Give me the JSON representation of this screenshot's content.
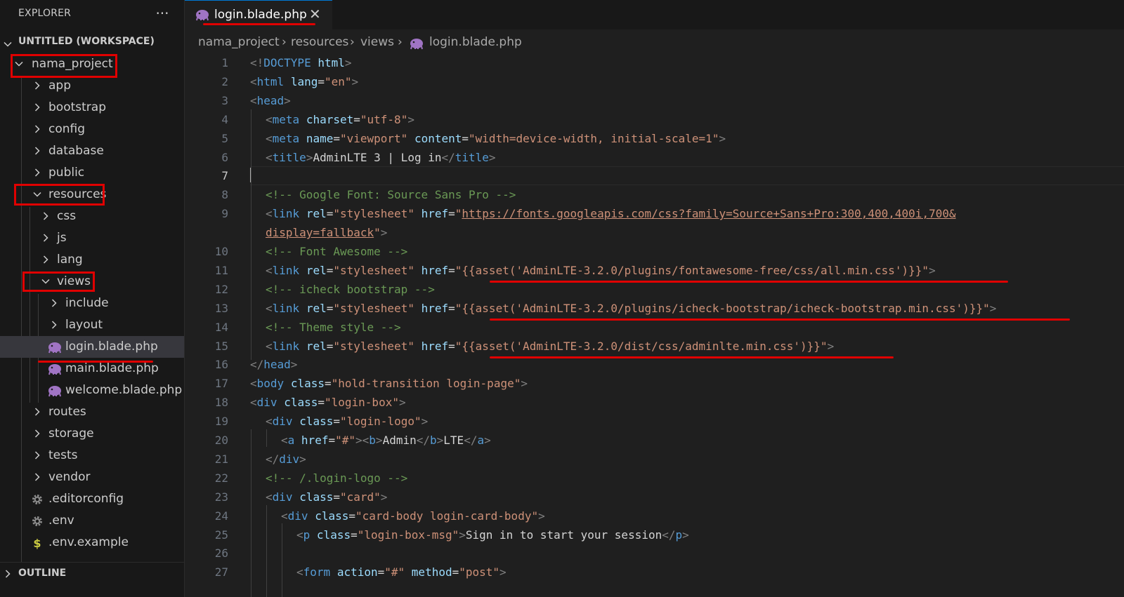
{
  "sidebar": {
    "title": "EXPLORER",
    "more": "···",
    "workspace": "UNTITLED (WORKSPACE)",
    "items": [
      {
        "label": "nama_project",
        "kind": "folder",
        "open": true
      },
      {
        "label": "app",
        "kind": "folder",
        "open": false
      },
      {
        "label": "bootstrap",
        "kind": "folder",
        "open": false
      },
      {
        "label": "config",
        "kind": "folder",
        "open": false
      },
      {
        "label": "database",
        "kind": "folder",
        "open": false
      },
      {
        "label": "public",
        "kind": "folder",
        "open": false
      },
      {
        "label": "resources",
        "kind": "folder",
        "open": true
      },
      {
        "label": "css",
        "kind": "folder",
        "open": false
      },
      {
        "label": "js",
        "kind": "folder",
        "open": false
      },
      {
        "label": "lang",
        "kind": "folder",
        "open": false
      },
      {
        "label": "views",
        "kind": "folder",
        "open": true
      },
      {
        "label": "include",
        "kind": "folder",
        "open": false
      },
      {
        "label": "layout",
        "kind": "folder",
        "open": false
      },
      {
        "label": "login.blade.php",
        "kind": "php",
        "selected": true
      },
      {
        "label": "main.blade.php",
        "kind": "php"
      },
      {
        "label": "welcome.blade.php",
        "kind": "php"
      },
      {
        "label": "routes",
        "kind": "folder",
        "open": false
      },
      {
        "label": "storage",
        "kind": "folder",
        "open": false
      },
      {
        "label": "tests",
        "kind": "folder",
        "open": false
      },
      {
        "label": "vendor",
        "kind": "folder",
        "open": false
      },
      {
        "label": ".editorconfig",
        "kind": "gear"
      },
      {
        "label": ".env",
        "kind": "gear"
      },
      {
        "label": ".env.example",
        "kind": "dollar"
      }
    ],
    "outline": "OUTLINE"
  },
  "tab": {
    "label": "login.blade.php",
    "close": "✕"
  },
  "breadcrumb": {
    "parts": [
      "nama_project",
      "resources",
      "views",
      "login.blade.php"
    ],
    "sep": "›"
  },
  "colors": {
    "accent": "#0078d4",
    "highlight_red": "#e00000",
    "php_icon": "#a074c4"
  },
  "editor": {
    "active_line": "7",
    "lines": [
      {
        "n": "1",
        "i": 0,
        "t": [
          [
            "p",
            "<!"
          ],
          [
            "t",
            "DOCTYPE"
          ],
          [
            "x",
            " "
          ],
          [
            "a",
            "html"
          ],
          [
            "p",
            ">"
          ]
        ]
      },
      {
        "n": "2",
        "i": 0,
        "t": [
          [
            "p",
            "<"
          ],
          [
            "t",
            "html"
          ],
          [
            "x",
            " "
          ],
          [
            "a",
            "lang"
          ],
          [
            "x",
            "="
          ],
          [
            "s",
            "\"en\""
          ],
          [
            "p",
            ">"
          ]
        ]
      },
      {
        "n": "3",
        "i": 0,
        "t": [
          [
            "p",
            "<"
          ],
          [
            "t",
            "head"
          ],
          [
            "p",
            ">"
          ]
        ]
      },
      {
        "n": "4",
        "i": 1,
        "t": [
          [
            "p",
            "<"
          ],
          [
            "t",
            "meta"
          ],
          [
            "x",
            " "
          ],
          [
            "a",
            "charset"
          ],
          [
            "x",
            "="
          ],
          [
            "s",
            "\"utf-8\""
          ],
          [
            "p",
            ">"
          ]
        ]
      },
      {
        "n": "5",
        "i": 1,
        "t": [
          [
            "p",
            "<"
          ],
          [
            "t",
            "meta"
          ],
          [
            "x",
            " "
          ],
          [
            "a",
            "name"
          ],
          [
            "x",
            "="
          ],
          [
            "s",
            "\"viewport\""
          ],
          [
            "x",
            " "
          ],
          [
            "a",
            "content"
          ],
          [
            "x",
            "="
          ],
          [
            "s",
            "\"width=device-width, initial-scale=1\""
          ],
          [
            "p",
            ">"
          ]
        ]
      },
      {
        "n": "6",
        "i": 1,
        "t": [
          [
            "p",
            "<"
          ],
          [
            "t",
            "title"
          ],
          [
            "p",
            ">"
          ],
          [
            "x",
            "AdminLTE 3 | Log in"
          ],
          [
            "p",
            "</"
          ],
          [
            "t",
            "title"
          ],
          [
            "p",
            ">"
          ]
        ]
      },
      {
        "n": "7",
        "i": 0,
        "t": []
      },
      {
        "n": "8",
        "i": 1,
        "t": [
          [
            "c",
            "<!-- Google Font: Source Sans Pro -->"
          ]
        ]
      },
      {
        "n": "9",
        "i": 1,
        "t": [
          [
            "p",
            "<"
          ],
          [
            "t",
            "link"
          ],
          [
            "x",
            " "
          ],
          [
            "a",
            "rel"
          ],
          [
            "x",
            "="
          ],
          [
            "s",
            "\"stylesheet\""
          ],
          [
            "x",
            " "
          ],
          [
            "a",
            "href"
          ],
          [
            "x",
            "="
          ],
          [
            "s",
            "\""
          ],
          [
            "u",
            "https://fonts.googleapis.com/css?family=Source+Sans+Pro:300,400,400i,700&"
          ]
        ]
      },
      {
        "n": "",
        "i": 1,
        "t": [
          [
            "u",
            "display=fallback"
          ],
          [
            "s",
            "\""
          ],
          [
            "p",
            ">"
          ]
        ]
      },
      {
        "n": "10",
        "i": 1,
        "t": [
          [
            "c",
            "<!-- Font Awesome -->"
          ]
        ]
      },
      {
        "n": "11",
        "i": 1,
        "t": [
          [
            "p",
            "<"
          ],
          [
            "t",
            "link"
          ],
          [
            "x",
            " "
          ],
          [
            "a",
            "rel"
          ],
          [
            "x",
            "="
          ],
          [
            "s",
            "\"stylesheet\""
          ],
          [
            "x",
            " "
          ],
          [
            "a",
            "href"
          ],
          [
            "x",
            "="
          ],
          [
            "s",
            "\"{{asset('AdminLTE-3.2.0/plugins/fontawesome-free/css/all.min.css')}}\""
          ],
          [
            "p",
            ">"
          ]
        ]
      },
      {
        "n": "12",
        "i": 1,
        "t": [
          [
            "c",
            "<!-- icheck bootstrap -->"
          ]
        ]
      },
      {
        "n": "13",
        "i": 1,
        "t": [
          [
            "p",
            "<"
          ],
          [
            "t",
            "link"
          ],
          [
            "x",
            " "
          ],
          [
            "a",
            "rel"
          ],
          [
            "x",
            "="
          ],
          [
            "s",
            "\"stylesheet\""
          ],
          [
            "x",
            " "
          ],
          [
            "a",
            "href"
          ],
          [
            "x",
            "="
          ],
          [
            "s",
            "\"{{asset('AdminLTE-3.2.0/plugins/icheck-bootstrap/icheck-bootstrap.min.css')}}\""
          ],
          [
            "p",
            ">"
          ]
        ]
      },
      {
        "n": "14",
        "i": 1,
        "t": [
          [
            "c",
            "<!-- Theme style -->"
          ]
        ]
      },
      {
        "n": "15",
        "i": 1,
        "t": [
          [
            "p",
            "<"
          ],
          [
            "t",
            "link"
          ],
          [
            "x",
            " "
          ],
          [
            "a",
            "rel"
          ],
          [
            "x",
            "="
          ],
          [
            "s",
            "\"stylesheet\""
          ],
          [
            "x",
            " "
          ],
          [
            "a",
            "href"
          ],
          [
            "x",
            "="
          ],
          [
            "s",
            "\"{{asset('AdminLTE-3.2.0/dist/css/adminlte.min.css')}}\""
          ],
          [
            "p",
            ">"
          ]
        ]
      },
      {
        "n": "16",
        "i": 0,
        "t": [
          [
            "p",
            "</"
          ],
          [
            "t",
            "head"
          ],
          [
            "p",
            ">"
          ]
        ]
      },
      {
        "n": "17",
        "i": 0,
        "t": [
          [
            "p",
            "<"
          ],
          [
            "t",
            "body"
          ],
          [
            "x",
            " "
          ],
          [
            "a",
            "class"
          ],
          [
            "x",
            "="
          ],
          [
            "s",
            "\"hold-transition login-page\""
          ],
          [
            "p",
            ">"
          ]
        ]
      },
      {
        "n": "18",
        "i": 0,
        "t": [
          [
            "p",
            "<"
          ],
          [
            "t",
            "div"
          ],
          [
            "x",
            " "
          ],
          [
            "a",
            "class"
          ],
          [
            "x",
            "="
          ],
          [
            "s",
            "\"login-box\""
          ],
          [
            "p",
            ">"
          ]
        ]
      },
      {
        "n": "19",
        "i": 1,
        "t": [
          [
            "p",
            "<"
          ],
          [
            "t",
            "div"
          ],
          [
            "x",
            " "
          ],
          [
            "a",
            "class"
          ],
          [
            "x",
            "="
          ],
          [
            "s",
            "\"login-logo\""
          ],
          [
            "p",
            ">"
          ]
        ]
      },
      {
        "n": "20",
        "i": 2,
        "t": [
          [
            "p",
            "<"
          ],
          [
            "t",
            "a"
          ],
          [
            "x",
            " "
          ],
          [
            "a",
            "href"
          ],
          [
            "x",
            "="
          ],
          [
            "s",
            "\"#\""
          ],
          [
            "p",
            ">"
          ],
          [
            "p",
            "<"
          ],
          [
            "t",
            "b"
          ],
          [
            "p",
            ">"
          ],
          [
            "x",
            "Admin"
          ],
          [
            "p",
            "</"
          ],
          [
            "t",
            "b"
          ],
          [
            "p",
            ">"
          ],
          [
            "x",
            "LTE"
          ],
          [
            "p",
            "</"
          ],
          [
            "t",
            "a"
          ],
          [
            "p",
            ">"
          ]
        ]
      },
      {
        "n": "21",
        "i": 1,
        "t": [
          [
            "p",
            "</"
          ],
          [
            "t",
            "div"
          ],
          [
            "p",
            ">"
          ]
        ]
      },
      {
        "n": "22",
        "i": 1,
        "t": [
          [
            "c",
            "<!-- /.login-logo -->"
          ]
        ]
      },
      {
        "n": "23",
        "i": 1,
        "t": [
          [
            "p",
            "<"
          ],
          [
            "t",
            "div"
          ],
          [
            "x",
            " "
          ],
          [
            "a",
            "class"
          ],
          [
            "x",
            "="
          ],
          [
            "s",
            "\"card\""
          ],
          [
            "p",
            ">"
          ]
        ]
      },
      {
        "n": "24",
        "i": 2,
        "t": [
          [
            "p",
            "<"
          ],
          [
            "t",
            "div"
          ],
          [
            "x",
            " "
          ],
          [
            "a",
            "class"
          ],
          [
            "x",
            "="
          ],
          [
            "s",
            "\"card-body login-card-body\""
          ],
          [
            "p",
            ">"
          ]
        ]
      },
      {
        "n": "25",
        "i": 3,
        "t": [
          [
            "p",
            "<"
          ],
          [
            "t",
            "p"
          ],
          [
            "x",
            " "
          ],
          [
            "a",
            "class"
          ],
          [
            "x",
            "="
          ],
          [
            "s",
            "\"login-box-msg\""
          ],
          [
            "p",
            ">"
          ],
          [
            "x",
            "Sign in to start your session"
          ],
          [
            "p",
            "</"
          ],
          [
            "t",
            "p"
          ],
          [
            "p",
            ">"
          ]
        ]
      },
      {
        "n": "26",
        "i": 0,
        "t": []
      },
      {
        "n": "27",
        "i": 3,
        "t": [
          [
            "p",
            "<"
          ],
          [
            "t",
            "form"
          ],
          [
            "x",
            " "
          ],
          [
            "a",
            "action"
          ],
          [
            "x",
            "="
          ],
          [
            "s",
            "\"#\""
          ],
          [
            "x",
            " "
          ],
          [
            "a",
            "method"
          ],
          [
            "x",
            "="
          ],
          [
            "s",
            "\"post\""
          ],
          [
            "p",
            ">"
          ]
        ]
      }
    ]
  }
}
